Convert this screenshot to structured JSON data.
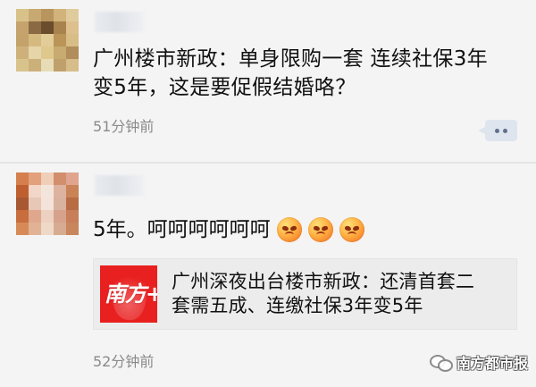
{
  "posts": [
    {
      "text_lines": [
        "广州楼市新政：单身限购一套 连续社保3年",
        "变5年，这是要促假结婚咯？"
      ],
      "time": "51分钟前",
      "avatar_colors": [
        "#d8c28a",
        "#c8a971",
        "#b9955e",
        "#d1b37b",
        "#e0cb9c",
        "#c6a26d",
        "#8a6a43",
        "#6b4c2c",
        "#a9834e",
        "#ddc08d",
        "#c3a36a",
        "#d5b97f",
        "#e2cd98",
        "#bb9457",
        "#d8bd86",
        "#ceb17a",
        "#e6d5a9",
        "#dfc88d",
        "#c7ab71",
        "#b18d59",
        "#d9c38d",
        "#cbb07a",
        "#e8dcb7",
        "#bfa06c",
        "#d6bd8a"
      ]
    },
    {
      "text": "5年。呵呵呵呵呵呵",
      "emoji": [
        "angry-face-icon",
        "angry-face-icon",
        "angry-face-icon"
      ],
      "link": {
        "thumbnail_text": "南方+",
        "title_lines": [
          "广州深夜出台楼市新政：还清首套二",
          "套需五成、连缴社保3年变5年"
        ]
      },
      "time": "52分钟前",
      "avatar_colors": [
        "#d57f4d",
        "#e2a17c",
        "#f0cfb8",
        "#d28f6e",
        "#e0a58e",
        "#bf5f2f",
        "#f2d7c8",
        "#f4e5dc",
        "#ddb39f",
        "#c98357",
        "#a75732",
        "#e7c7b6",
        "#f3e3da",
        "#d9b19f",
        "#b86c44",
        "#c86d3d",
        "#dfa78d",
        "#ecd0c1",
        "#d6a28b",
        "#c77e59",
        "#d68a58",
        "#e1b394",
        "#efd8c8",
        "#d7ab91",
        "#c9865d"
      ]
    }
  ],
  "watermark": "南方都市报"
}
